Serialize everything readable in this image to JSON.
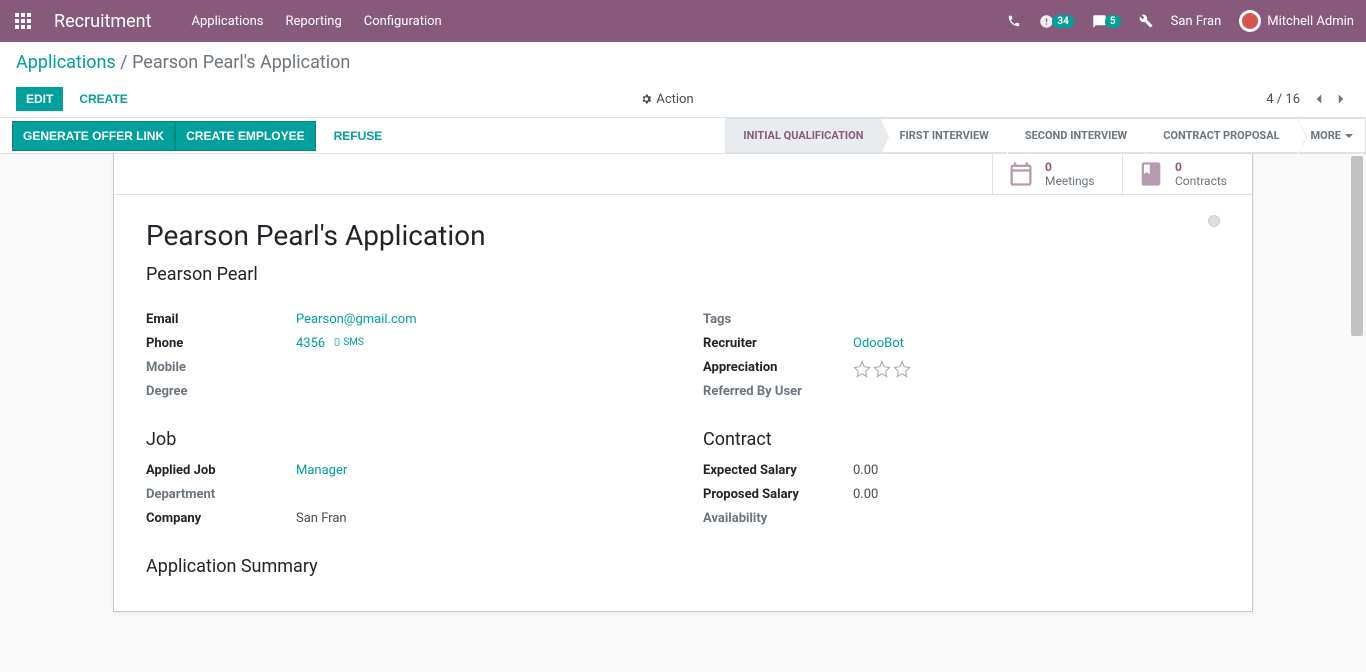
{
  "navbar": {
    "brand": "Recruitment",
    "menu": [
      "Applications",
      "Reporting",
      "Configuration"
    ],
    "activities_count": "34",
    "messages_count": "5",
    "company": "San Fran",
    "user": "Mitchell Admin"
  },
  "breadcrumb": {
    "parent": "Applications",
    "current": "Pearson Pearl's Application"
  },
  "controls": {
    "edit": "EDIT",
    "create": "CREATE",
    "action": "Action",
    "pager": "4 / 16"
  },
  "actions": {
    "offer": "GENERATE OFFER LINK",
    "employee": "CREATE EMPLOYEE",
    "refuse": "REFUSE"
  },
  "stages": [
    "INITIAL QUALIFICATION",
    "FIRST INTERVIEW",
    "SECOND INTERVIEW",
    "CONTRACT PROPOSAL"
  ],
  "more": "MORE",
  "stats": {
    "meetings_count": "0",
    "meetings_label": "Meetings",
    "contracts_count": "0",
    "contracts_label": "Contracts"
  },
  "form": {
    "title": "Pearson Pearl's Application",
    "name": "Pearson Pearl",
    "labels": {
      "email": "Email",
      "phone": "Phone",
      "mobile": "Mobile",
      "degree": "Degree",
      "tags": "Tags",
      "recruiter": "Recruiter",
      "appreciation": "Appreciation",
      "referred": "Referred By User",
      "job_hd": "Job",
      "applied_job": "Applied Job",
      "department": "Department",
      "company": "Company",
      "contract_hd": "Contract",
      "expected": "Expected Salary",
      "proposed": "Proposed Salary",
      "availability": "Availability",
      "summary_hd": "Application Summary"
    },
    "values": {
      "email": "Pearson@gmail.com",
      "phone": "4356",
      "sms": "SMS",
      "recruiter": "OdooBot",
      "applied_job": "Manager",
      "company": "San Fran",
      "expected": "0.00",
      "proposed": "0.00"
    }
  }
}
